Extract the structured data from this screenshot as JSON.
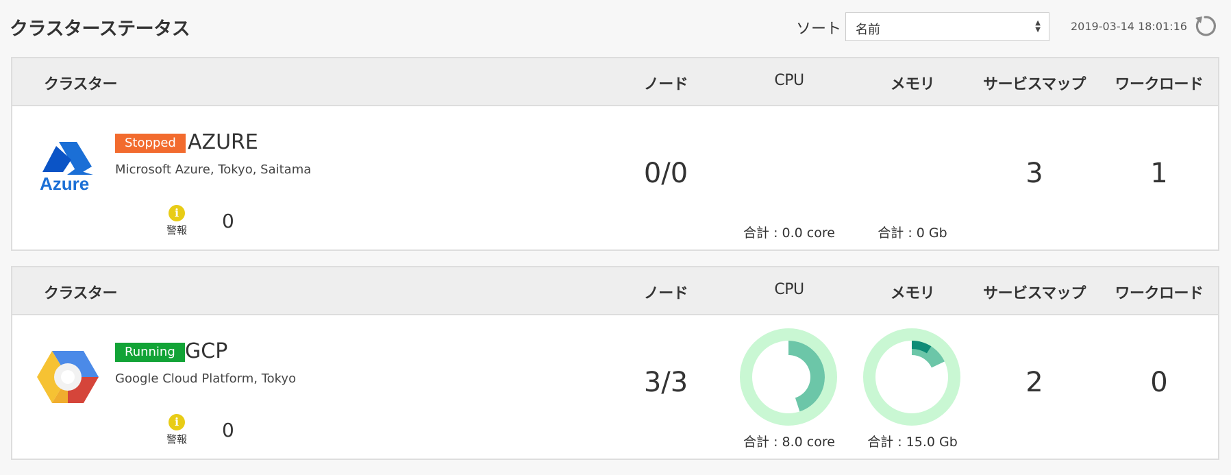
{
  "header": {
    "title": "クラスターステータス",
    "sort_label": "ソート",
    "sort_value": "名前",
    "timestamp": "2019-03-14 18:01:16"
  },
  "columns": {
    "cluster": "クラスター",
    "nodes": "ノード",
    "cpu": "CPU",
    "memory": "メモリ",
    "service_map": "サービスマップ",
    "workload": "ワークロード"
  },
  "clusters": [
    {
      "logo": "azure-logo",
      "logo_text": "Azure",
      "status": "Stopped",
      "status_color": "#f26b2e",
      "name": "AZURE",
      "description": "Microsoft Azure, Tokyo, Saitama",
      "alert_label": "警報",
      "alert_count": "0",
      "nodes": "0/0",
      "cpu_total": "合計 : 0.0 core",
      "memory_total": "合計 : 0 Gb",
      "service_map": "3",
      "workload": "1"
    },
    {
      "logo": "gcp-logo",
      "status": "Running",
      "status_color": "#12a336",
      "name": "GCP",
      "description": "Google Cloud Platform, Tokyo",
      "alert_label": "警報",
      "alert_count": "0",
      "nodes": "3/3",
      "cpu_total": "合計 : 8.0 core",
      "memory_total": "合計 : 15.0 Gb",
      "cpu_usage_fraction": 0.45,
      "memory_usage_fraction": 0.18,
      "memory_inner_fraction": 0.09,
      "service_map": "2",
      "workload": "0"
    }
  ],
  "colors": {
    "donut_track": "#c9f7d3",
    "donut_fill": "#6cc6a8",
    "donut_inner": "#0e8c76"
  }
}
